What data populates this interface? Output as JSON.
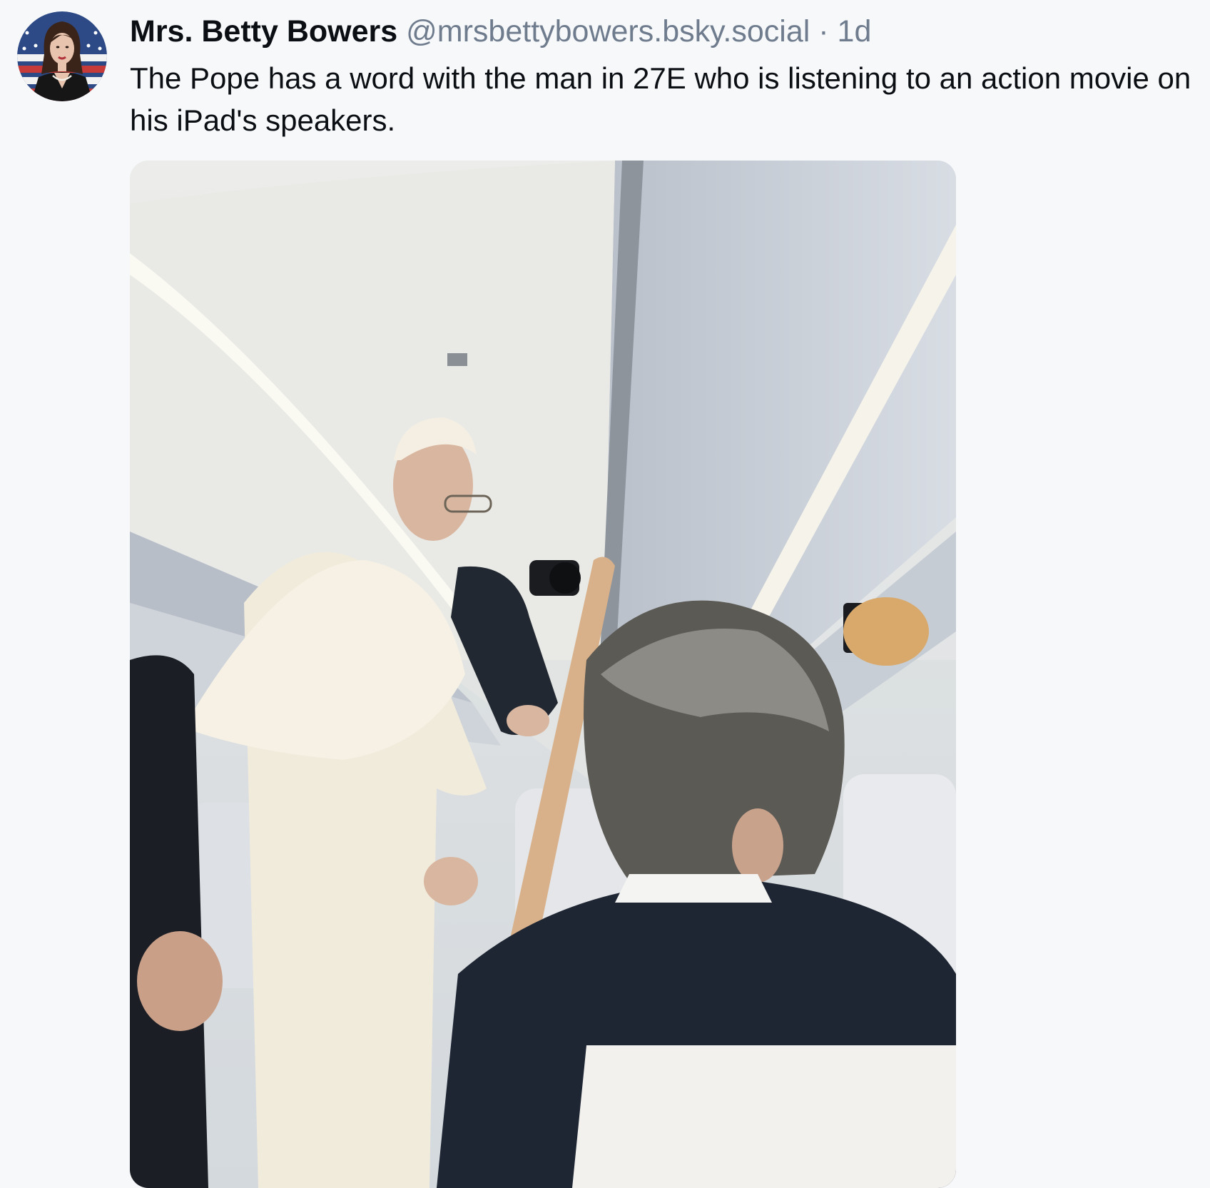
{
  "post": {
    "author": {
      "display_name": "Mrs. Betty Bowers",
      "handle": "@mrsbettybowers.bsky.social",
      "avatar_icon": "profile-avatar"
    },
    "separator": "·",
    "time_ago": "1d",
    "text": "The Pope has a word with the man in 27E who is listening to an action movie on his iPad's speakers.",
    "media": {
      "type": "photo",
      "alt": ""
    }
  },
  "colors": {
    "background": "#f7f8fa",
    "text_primary": "#0b0f14",
    "text_secondary": "#6f7c8e"
  }
}
